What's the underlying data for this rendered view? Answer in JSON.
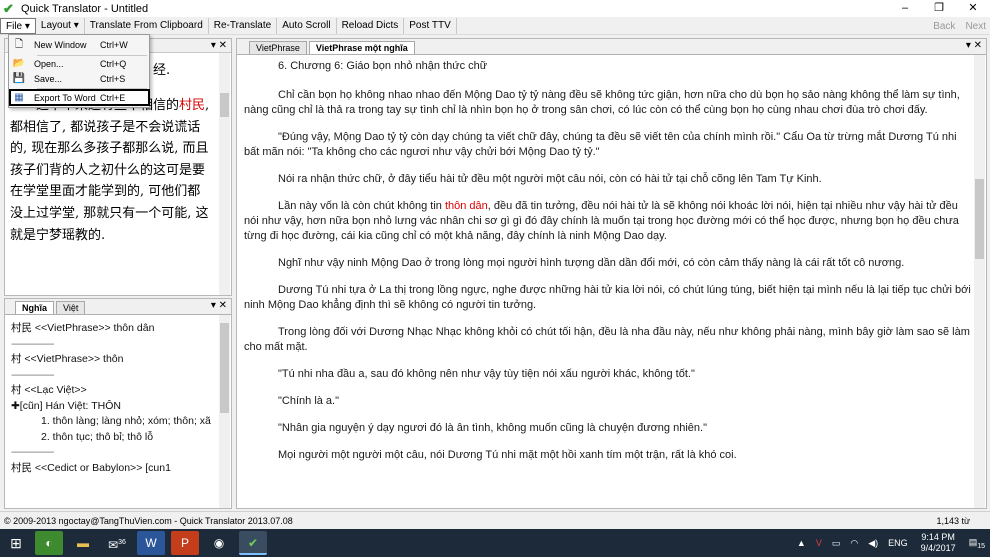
{
  "window": {
    "title": "Quick Translator - Untitled",
    "minimize": "–",
    "maximize": "❐",
    "close": "✕"
  },
  "toolbar": {
    "file": "File ▾",
    "layout": "Layout ▾",
    "translate_clipboard": "Translate From Clipboard",
    "retranslate": "Re-Translate",
    "auto_scroll": "Auto Scroll",
    "reload_dicts": "Reload Dicts",
    "post_ttv": "Post TTV",
    "back": "Back",
    "next": "Next"
  },
  "file_menu": [
    {
      "label": "New Window",
      "shortcut": "Ctrl+W"
    },
    {
      "label": "Open...",
      "shortcut": "Ctrl+Q"
    },
    {
      "label": "Save...",
      "shortcut": "Ctrl+S"
    },
    {
      "label": "Export To Word",
      "shortcut": "Ctrl+E"
    }
  ],
  "left_top": {
    "first_line": "经.",
    "text_a": "这下本来还有些不相信的",
    "text_red": "村民",
    "text_b": ", 都相信了, 都说孩子是不会说谎话的, 现在那么多孩子都那么说, 而且孩子们背的人之初什么的这可是要在学堂里面才能学到的, 可他们都没上过学堂, 那就只有一个可能, 这就是宁梦瑶教的."
  },
  "left_bottom": {
    "tabs": [
      "Nghĩa",
      "Việt"
    ],
    "lines": [
      "村民 <<VietPhrase>> thôn dân",
      "-----------------",
      "村 <<VietPhrase>> thôn",
      "-----------------",
      "村 <<Lạc Việt>>",
      "✚[cũn] Hán Việt: THÔN",
      "1. thôn làng; làng nhỏ; xóm; thôn; xã",
      "2. thôn tục; thô bỉ; thô lỗ",
      "-----------------",
      "村民 <<Cedict or Babylon>> [cun1"
    ]
  },
  "main": {
    "tabs": [
      "VietPhrase",
      "VietPhrase một nghĩa"
    ],
    "heading": "6. Chương 6: Giáo bọn nhỏ nhận thức chữ",
    "p1": "Chỉ cần bọn họ không nhao nhao đến Mộng Dao tỷ tỷ nàng đều sẽ không tức giận, hơn nữa cho dù bọn họ sảo nàng không thể làm sự tình, nàng cũng chỉ là thả ra trong tay sự tình chỉ là nhìn bọn họ ở trong sân chơi, có lúc còn có thể cùng bọn họ cùng nhau chơi đùa trò chơi đấy.",
    "p2": "\"Đúng vậy, Mộng Dao tỷ tỷ còn dạy chúng ta viết chữ đây, chúng ta đều sẽ viết tên của chính mình rồi.\" Cẩu Oa từ trừng mắt Dương Tú nhi bất mãn nói: \"Ta không cho các ngươi như vậy chửi bới Mộng Dao tỷ tỷ.\"",
    "p3": "Nói ra nhận thức chữ, ở đây tiểu hài tử đều một người một câu nói, còn có hài tử tại chỗ cõng lên Tam Tự Kinh.",
    "p4a": "Lần này vốn là còn chút không tin ",
    "p4red": "thôn dân",
    "p4b": ", đều đã tin tưởng, đều nói hài tử là sẽ không nói khoác lời nói, hiện tại nhiều như vậy hài tử đều nói như vậy, hơn nữa bọn nhỏ lưng vác nhân chi sơ gì gì đó đây chính là muốn tại trong học đường mới có thể học được, nhưng bọn họ đều chưa từng đi học đường, cái kia cũng chỉ có một khả năng, đây chính là ninh Mộng Dao dạy.",
    "p5": "Nghĩ như vậy ninh Mộng Dao ở trong lòng mọi người hình tượng dần dần đổi mới, có còn cảm thấy nàng là cái rất tốt cô nương.",
    "p6": "Dương Tú nhi tựa ở La thị trong lồng ngực, nghe được những hài tử kia lời nói, có chút lúng túng, biết hiện tại mình nếu là lại tiếp tục chửi bới ninh Mộng Dao khẳng định thì sẽ không có người tin tưởng.",
    "p7": "Trong lòng đối với Dương Nhạc Nhạc không khỏi có chút tối hận, đều là nha đầu này, nếu như không phải nàng, mình bây giờ làm sao sẽ làm cho mất mặt.",
    "p8": "\"Tú nhi nha đầu a, sau đó không nên như vậy tùy tiện nói xấu người khác, không tốt.\"",
    "p9": "\"Chính là a.\"",
    "p10": "\"Nhân gia nguyện ý dạy ngươi đó là ân tình, không muốn cũng là chuyện đương nhiên.\"",
    "p11": "Mọi người một người một câu, nói Dương Tú nhi mặt một hồi xanh tím một trận, rất là khó coi."
  },
  "status": {
    "left": "© 2009-2013 ngoctay@TangThuVien.com - Quick Translator 2013.07.08",
    "right": "1,143 từ"
  },
  "taskbar": {
    "lang": "ENG",
    "time": "9:14 PM",
    "date": "9/4/2017",
    "badge1": "36",
    "badge2": "15"
  }
}
